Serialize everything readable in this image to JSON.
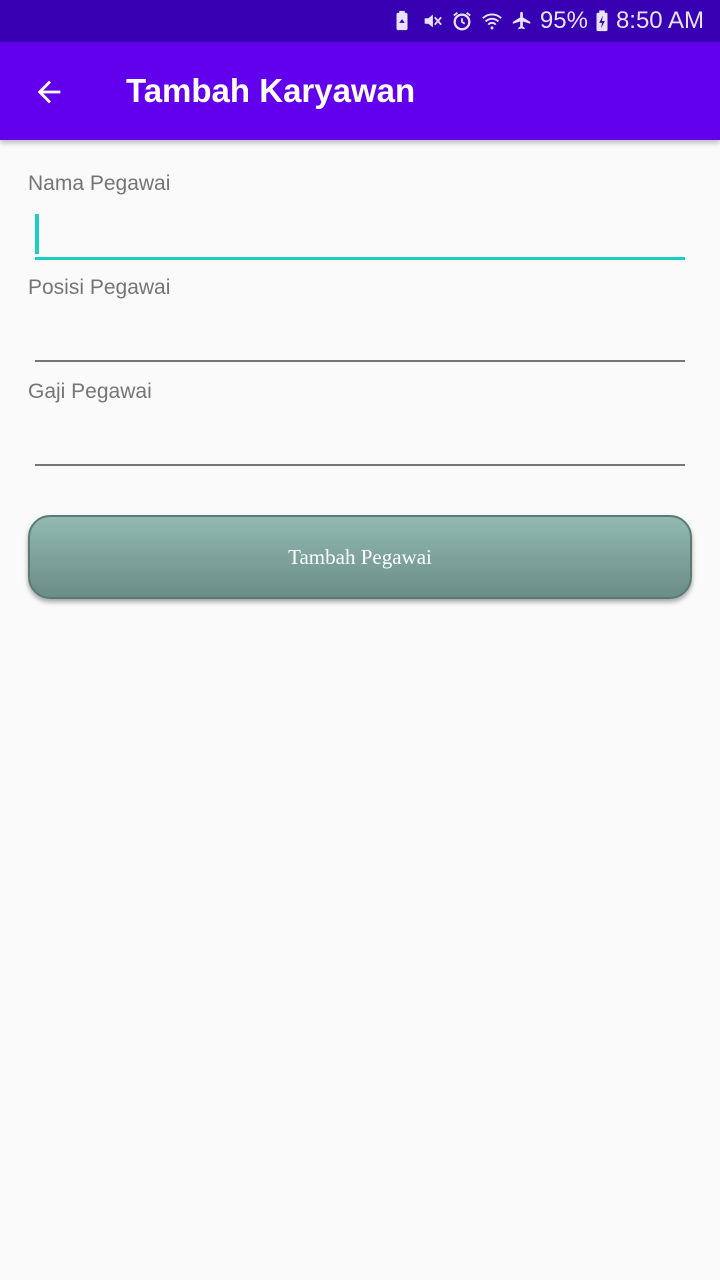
{
  "status_bar": {
    "battery": "95%",
    "time": "8:50 AM",
    "icons": [
      "battery-saver-icon",
      "vibrate-mute-icon",
      "alarm-icon",
      "wifi-icon",
      "airplane-icon",
      "battery-charging-icon"
    ]
  },
  "app_bar": {
    "title": "Tambah Karyawan",
    "back_icon": "arrow-back-icon"
  },
  "form": {
    "nama": {
      "label": "Nama Pegawai",
      "value": ""
    },
    "posisi": {
      "label": "Posisi Pegawai",
      "value": ""
    },
    "gaji": {
      "label": "Gaji Pegawai",
      "value": ""
    },
    "submit_label": "Tambah Pegawai"
  },
  "colors": {
    "status_bar": "#3700b3",
    "app_bar": "#6200ee",
    "focus_accent": "#1ccfc2",
    "button": "#7ea39d",
    "background": "#fafafa"
  }
}
